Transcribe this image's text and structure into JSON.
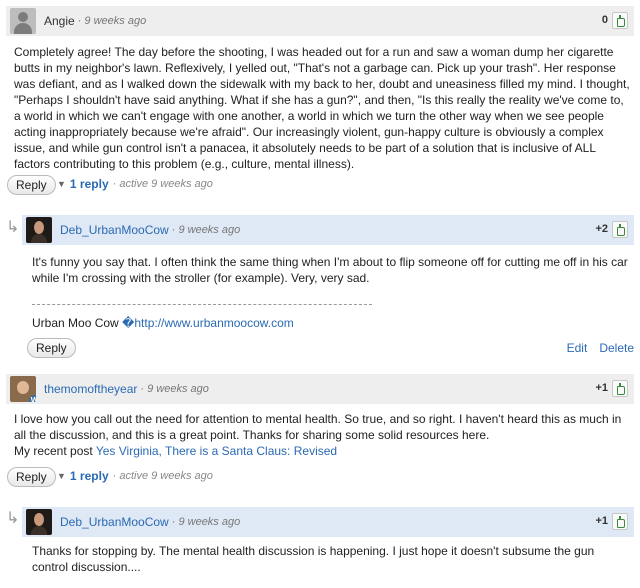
{
  "comments": [
    {
      "author": "Angie",
      "time": "· 9 weeks ago",
      "score": "0",
      "text": "Completely agree! The day before the shooting, I was headed out for a run and saw a woman dump her cigarette butts in my neighbor's lawn. Reflexively, I yelled out, \"That's not a garbage can. Pick up your trash\". Her response was defiant, and as I walked down the sidewalk with my back to her, doubt and uneasiness filled my mind. I thought, \"Perhaps I shouldn't have said anything. What if she has a gun?\", and then, \"Is this really the reality we've come to, a world in which we can't engage with one another, a world in which we turn the other way when we see people acting inappropriately because we're afraid\". Our increasingly violent, gun-happy culture is obviously a complex issue, and while gun control isn't a panacea, it absolutely needs to be part of a solution that is inclusive of ALL factors contributing to this problem (e.g., culture, mental illness).",
      "reply_label": "Reply",
      "replies_count": "1 reply",
      "replies_active": "· active 9 weeks ago"
    },
    {
      "author": "Deb_UrbanMooCow",
      "time": "· 9 weeks ago",
      "score": "+2",
      "text": "It's funny you say that. I often think the same thing when I'm about to flip someone off for cutting me off in his car while I'm crossing with the stroller (for example). Very, very sad.",
      "sig_name": "Urban Moo Cow ",
      "sig_sep": "�",
      "sig_link": "http://www.urbanmoocow.com",
      "reply_label": "Reply",
      "edit_label": "Edit",
      "delete_label": "Delete"
    },
    {
      "author": "themomoftheyear",
      "time": "· 9 weeks ago",
      "score": "+1",
      "text": "I love how you call out the need for attention to mental health. So true, and so right. I haven't heard this as much in all the discussion, and this is a great point. Thanks for sharing some solid resources here.",
      "recent_prefix": "My recent post ",
      "recent_link": "Yes Virginia, There is a Santa Claus: Revised",
      "reply_label": "Reply",
      "replies_count": "1 reply",
      "replies_active": "· active 9 weeks ago"
    },
    {
      "author": "Deb_UrbanMooCow",
      "time": "· 9 weeks ago",
      "score": "+1",
      "text": "Thanks for stopping by. The mental health discussion is happening. I just hope it doesn't subsume the gun control discussion...."
    }
  ],
  "icons": {
    "thread_arrow": "↳",
    "expand_triangle": "▼",
    "wordpress_badge": "W"
  }
}
